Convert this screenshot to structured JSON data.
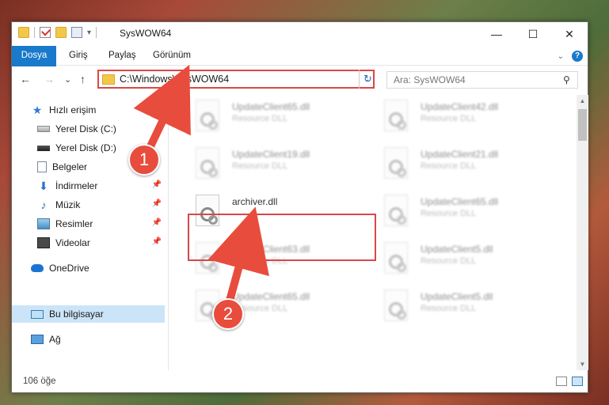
{
  "window": {
    "title": "SysWOW64",
    "caption": {
      "minimize": "—",
      "maximize": "☐",
      "close": "✕"
    }
  },
  "ribbon": {
    "tabs": [
      "Dosya",
      "Giriş",
      "Paylaş",
      "Görünüm"
    ],
    "help": "?"
  },
  "nav": {
    "back": "←",
    "forward": "→",
    "recent": "⌄",
    "up": "↑",
    "address": "C:\\Windows\\SysWOW64",
    "search_placeholder": "Ara: SysWOW64"
  },
  "sidebar": {
    "items": [
      {
        "label": "Hızlı erişim",
        "icon": "star-icon"
      },
      {
        "label": "Yerel Disk (C:)",
        "icon": "drive-icon"
      },
      {
        "label": "Yerel Disk (D:)",
        "icon": "drive-icon"
      },
      {
        "label": "Belgeler",
        "icon": "documents-icon"
      },
      {
        "label": "İndirmeler",
        "icon": "download-icon"
      },
      {
        "label": "Müzik",
        "icon": "music-icon"
      },
      {
        "label": "Resimler",
        "icon": "pictures-icon"
      },
      {
        "label": "Videolar",
        "icon": "videos-icon"
      },
      {
        "label": "OneDrive",
        "icon": "onedrive-icon"
      },
      {
        "label": "Bu bilgisayar",
        "icon": "computer-icon"
      },
      {
        "label": "Ağ",
        "icon": "network-icon"
      }
    ]
  },
  "files": [
    {
      "name": "UpdateClient65.dll",
      "type": "Resource DLL"
    },
    {
      "name": "UpdateClient42.dll",
      "type": "Resource DLL"
    },
    {
      "name": "UpdateClient19.dll",
      "type": "Resource DLL"
    },
    {
      "name": "UpdateClient21.dll",
      "type": "Resource DLL"
    },
    {
      "name": "archiver.dll",
      "type": ""
    },
    {
      "name": "UpdateClient65.dll",
      "type": "Resource DLL"
    },
    {
      "name": "UpdateClient63.dll",
      "type": "Resource DLL"
    },
    {
      "name": "UpdateClient5.dll",
      "type": "Resource DLL"
    },
    {
      "name": "UpdateClient65.dll",
      "type": "Resource DLL"
    },
    {
      "name": "UpdateClient5.dll",
      "type": "Resource DLL"
    }
  ],
  "status": {
    "count": "106 öğe"
  },
  "callouts": {
    "one": "1",
    "two": "2"
  },
  "colors": {
    "accent": "#1979ca",
    "highlight": "#d94848",
    "callout": "#e84c3d"
  }
}
